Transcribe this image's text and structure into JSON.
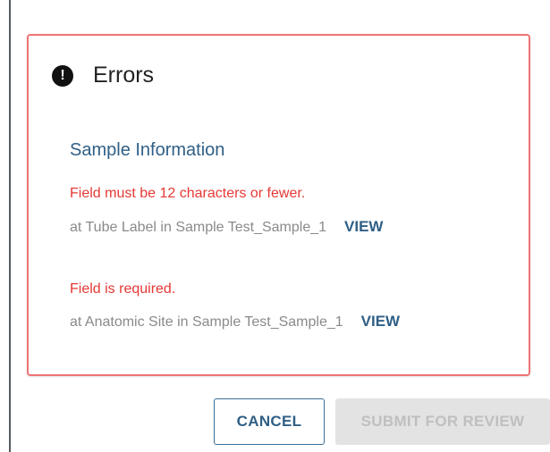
{
  "errors_panel": {
    "title": "Errors",
    "icon": "alert-circle-icon",
    "section_heading": "Sample Information",
    "errors": [
      {
        "message": "Field must be 12 characters or fewer.",
        "location": "at Tube Label in Sample Test_Sample_1",
        "view_label": "VIEW"
      },
      {
        "message": "Field is required.",
        "location": "at Anatomic Site in Sample Test_Sample_1",
        "view_label": "VIEW"
      }
    ]
  },
  "actions": {
    "cancel_label": "CANCEL",
    "submit_label": "SUBMIT FOR REVIEW"
  },
  "colors": {
    "panel_border": "#ef7474",
    "error_text": "#e53935",
    "link": "#2f5f86",
    "disabled_bg": "#e3e3e3",
    "disabled_text": "#bfbfbf"
  }
}
